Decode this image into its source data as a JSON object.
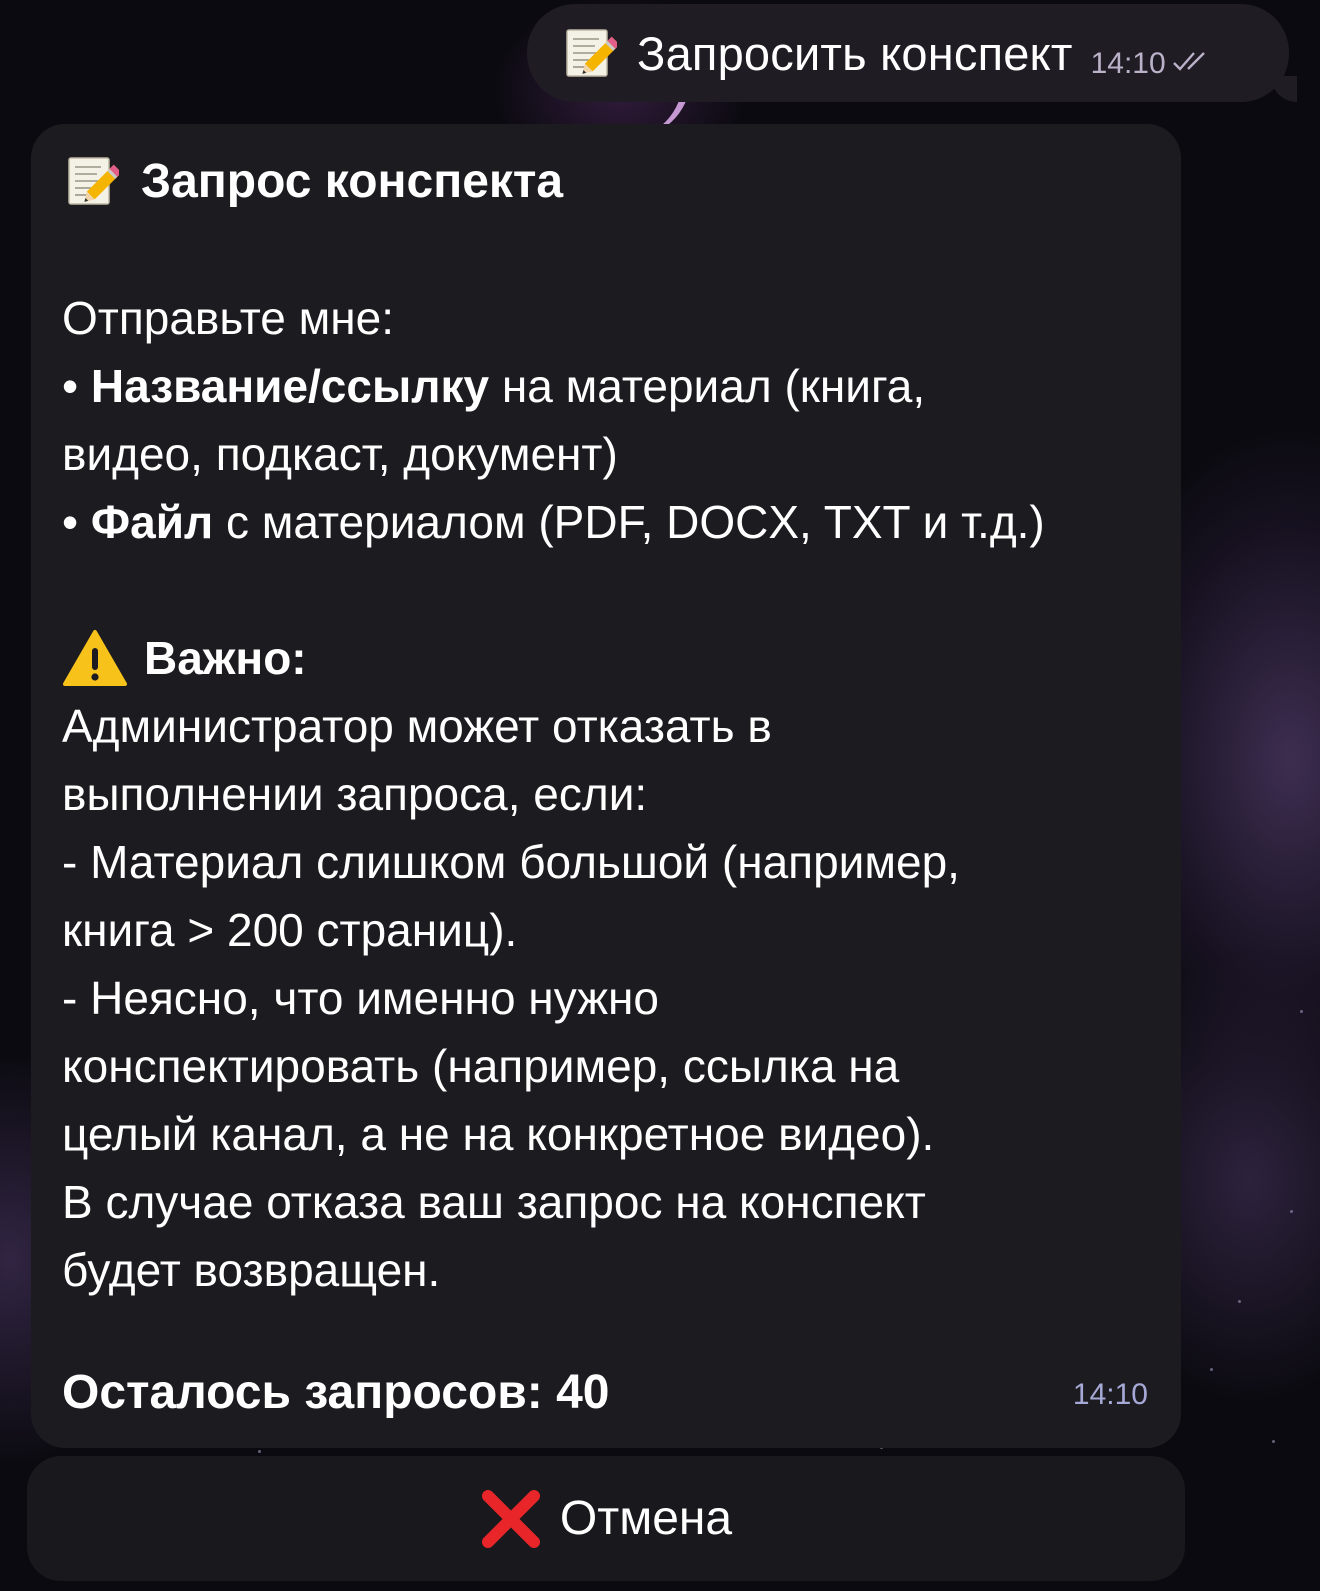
{
  "outgoing_message": {
    "icon": "memo-icon",
    "text": "Запросить конспект",
    "time": "14:10",
    "status": "read-double-check-icon"
  },
  "incoming_message": {
    "icon": "memo-icon",
    "title": "Запрос конспекта",
    "intro": "Отправьте мне:",
    "bullet1_bold": "Название/ссылку",
    "bullet1_line1_rest": " на материал (книга,",
    "bullet1_line2": "видео, подкаст, документ)",
    "bullet2_bold": "Файл",
    "bullet2_rest": " с материалом (PDF, DOCX, TXT и т.д.)",
    "bullet_symbol": "• ",
    "warning_icon": "warning-icon",
    "warning_label": "Важно:",
    "warning_lines": [
      "Администратор может отказать в",
      "выполнении запроса, если:",
      "- Материал слишком большой (например,",
      "книга > 200 страниц).",
      "- Неясно, что именно нужно",
      "конспектировать (например, ссылка на",
      "целый канал, а не на конкретное видео).",
      "В случае отказа ваш запрос на конспект",
      "будет возвращен."
    ],
    "remaining": "Осталось запросов: 40",
    "time": "14:10"
  },
  "keyboard": {
    "cancel_icon": "cross-mark-icon",
    "cancel_label": "Отмена"
  },
  "colors": {
    "background": "#0b0a10",
    "bubble": "#1c1b20",
    "outgoing_bubble": "#1f1c24",
    "time_incoming": "#a6a9d6",
    "cancel_x": "#e8262a"
  }
}
